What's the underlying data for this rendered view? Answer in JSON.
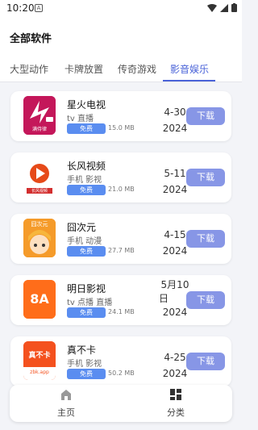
{
  "status": {
    "time": "10:20",
    "a_label": "A"
  },
  "header": {
    "title": "全部软件"
  },
  "tabs": [
    {
      "label": "大型动作"
    },
    {
      "label": "卡牌放置"
    },
    {
      "label": "传奇游戏"
    },
    {
      "label": "影音娱乐"
    }
  ],
  "active_tab": "影音娱乐",
  "apps": [
    {
      "name": "星火电视",
      "tags": "tv 直播",
      "badge": "免费",
      "size": "15.0 MB",
      "date_line1": "4-30",
      "date_line2": "2024",
      "button": "下载",
      "icon_text": "满侍律"
    },
    {
      "name": "长风视频",
      "tags": "手机 影视",
      "badge": "免费",
      "size": "21.0 MB",
      "date_line1": "5-11",
      "date_line2": "2024",
      "button": "下载",
      "icon_text": "长风视频"
    },
    {
      "name": "囧次元",
      "tags": "手机 动漫",
      "badge": "免费",
      "size": "27.7 MB",
      "date_line1": "4-15",
      "date_line2": "2024",
      "button": "下载",
      "icon_text": "囧次元"
    },
    {
      "name": "明日影视",
      "tags": "tv 点播 直播",
      "badge": "免费",
      "size": "24.1 MB",
      "date_line1": "5月10",
      "date_line2": "日",
      "date_line3": "2024",
      "button": "下载",
      "icon_text": "8A"
    },
    {
      "name": "真不卡",
      "tags": "手机 影视",
      "badge": "免费",
      "size": "50.2 MB",
      "date_line1": "4-25",
      "date_line2": "2024",
      "button": "下载",
      "icon_text": "真不卡",
      "icon_subtext": "zbk.app"
    }
  ],
  "bottom_nav": {
    "home_label": "主页",
    "category_label": "分类"
  },
  "colors": {
    "accent": "#4a63d8",
    "button": "#8796e6",
    "badge": "#5a8df0"
  }
}
